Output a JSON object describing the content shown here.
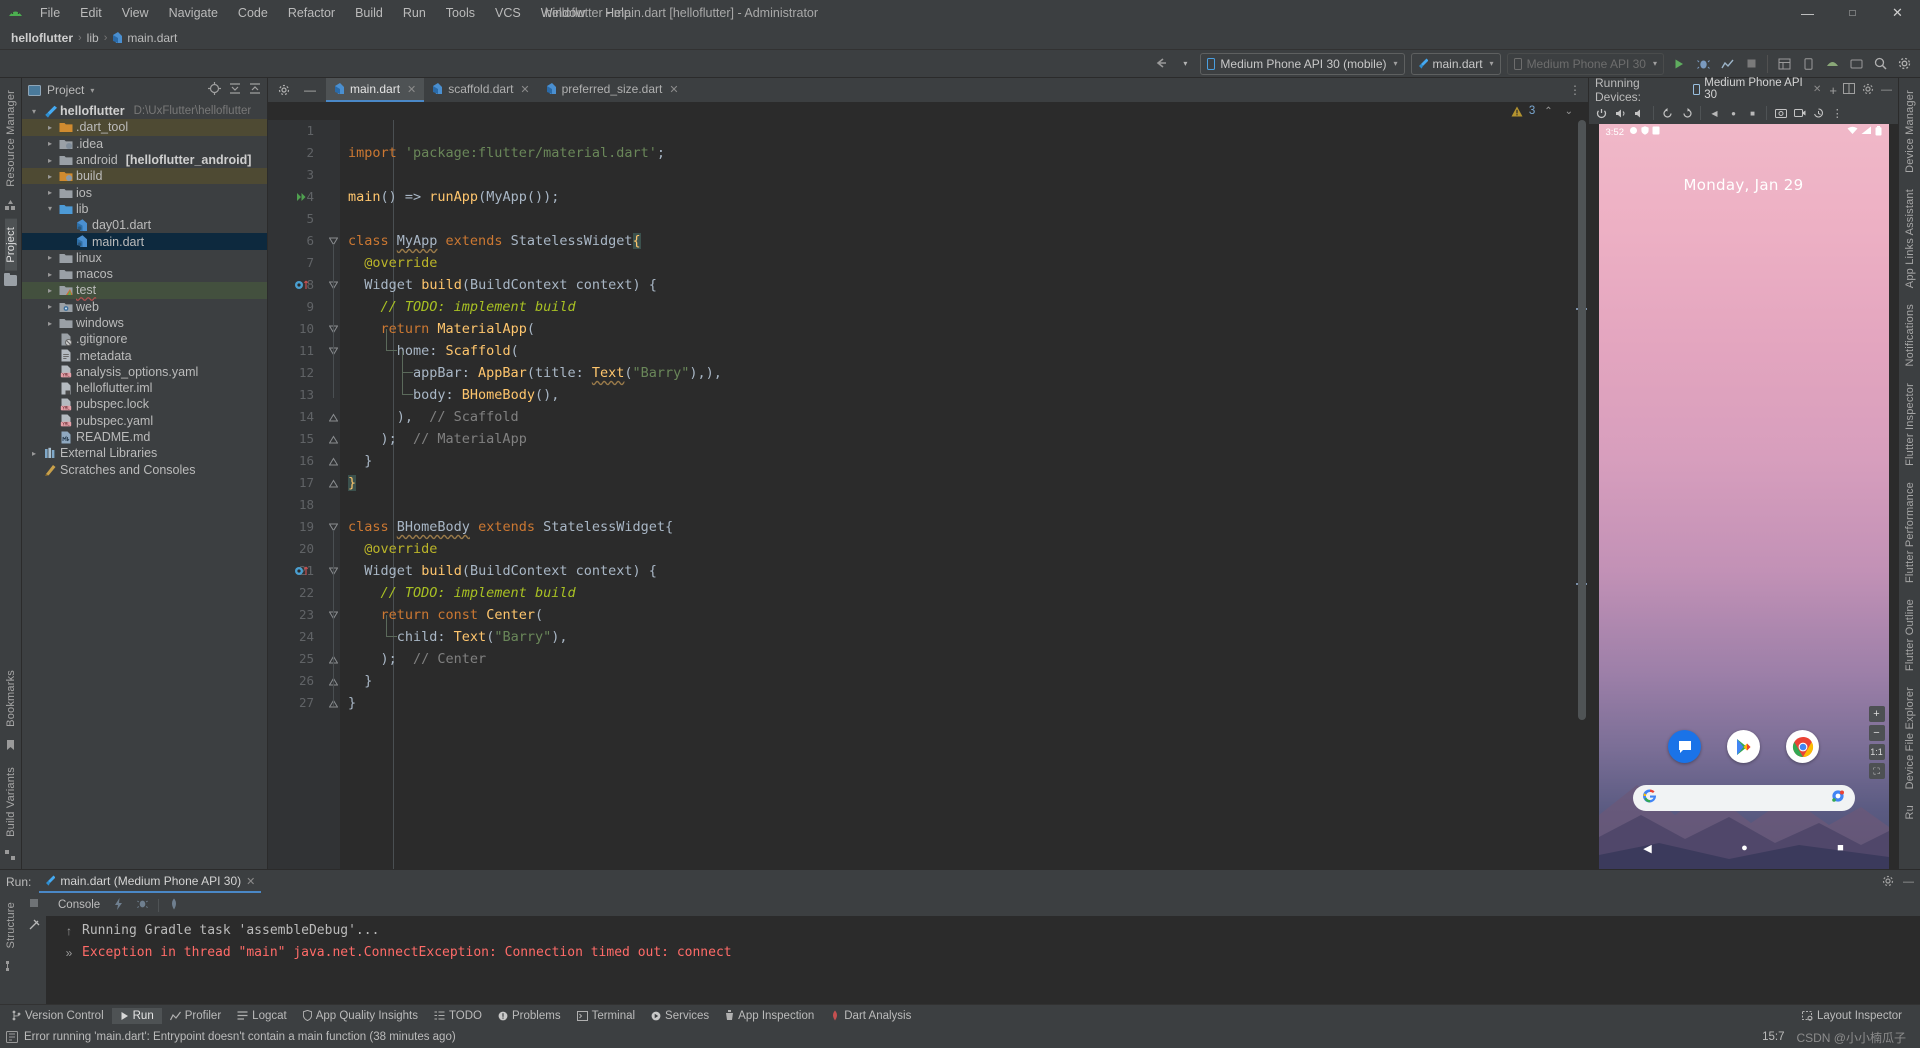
{
  "window": {
    "title": "helloflutter - main.dart [helloflutter] - Administrator",
    "minimize": "—",
    "maximize": "☐",
    "close": "✕"
  },
  "menubar": {
    "items": [
      {
        "label": "File"
      },
      {
        "label": "Edit"
      },
      {
        "label": "View"
      },
      {
        "label": "Navigate"
      },
      {
        "label": "Code"
      },
      {
        "label": "Refactor"
      },
      {
        "label": "Build"
      },
      {
        "label": "Run"
      },
      {
        "label": "Tools"
      },
      {
        "label": "VCS"
      },
      {
        "label": "Window"
      },
      {
        "label": "Help"
      }
    ]
  },
  "breadcrumb": {
    "project": "helloflutter",
    "folder": "lib",
    "file": "main.dart",
    "separator": "›"
  },
  "toolbar": {
    "device_combo": "Medium Phone API 30 (mobile)",
    "run_config_combo": "main.dart",
    "device_combo2": "Medium Phone API 30",
    "run_icon": "▶",
    "debug_icon": "🐞",
    "stop_icon": "■",
    "caret": "▾",
    "search_icon": "🔍",
    "settings_icon": "⚙",
    "back_arrow": "↰"
  },
  "left_strips": [
    {
      "label": "Resource Manager",
      "active": false
    },
    {
      "label": "Project",
      "active": true
    }
  ],
  "left_strips_bottom": [
    {
      "label": "Bookmarks"
    },
    {
      "label": "Build Variants"
    },
    {
      "label": "Structure"
    }
  ],
  "right_strips": [
    {
      "label": "Device Manager"
    },
    {
      "label": "App Links Assistant"
    },
    {
      "label": "Notifications"
    },
    {
      "label": "Flutter Inspector"
    },
    {
      "label": "Flutter Performance"
    },
    {
      "label": "Flutter Outline"
    },
    {
      "label": "Device File Explorer"
    },
    {
      "label": "Ru"
    }
  ],
  "project_panel": {
    "title": "Project",
    "caret": "▾",
    "tools": [
      "⊕",
      "⤓",
      "⤒"
    ],
    "tree": [
      {
        "depth": 0,
        "arrow": "v",
        "icon": "flutter",
        "label": "helloflutter",
        "bold": true,
        "sub": "D:\\UxFlutter\\helloflutter",
        "state": "none"
      },
      {
        "depth": 1,
        "arrow": ">",
        "icon": "folder-orange",
        "label": ".dart_tool",
        "state": "yellow"
      },
      {
        "depth": 1,
        "arrow": ">",
        "icon": "folder-module",
        "label": ".idea",
        "state": "none"
      },
      {
        "depth": 1,
        "arrow": ">",
        "icon": "folder-grey",
        "label": "android",
        "suffix": "[helloflutter_android]",
        "state": "none"
      },
      {
        "depth": 1,
        "arrow": ">",
        "icon": "folder-orange-mod",
        "label": "build",
        "state": "yellow"
      },
      {
        "depth": 1,
        "arrow": ">",
        "icon": "folder-grey",
        "label": "ios",
        "state": "none"
      },
      {
        "depth": 1,
        "arrow": "v",
        "icon": "folder-blue",
        "label": "lib",
        "state": "none"
      },
      {
        "depth": 2,
        "arrow": "",
        "icon": "dart",
        "label": "day01.dart",
        "state": "none"
      },
      {
        "depth": 2,
        "arrow": "",
        "icon": "dart",
        "label": "main.dart",
        "state": "selected"
      },
      {
        "depth": 1,
        "arrow": ">",
        "icon": "folder-grey",
        "label": "linux",
        "state": "none"
      },
      {
        "depth": 1,
        "arrow": ">",
        "icon": "folder-grey",
        "label": "macos",
        "state": "none"
      },
      {
        "depth": 1,
        "arrow": ">",
        "icon": "folder-test",
        "label": "test",
        "state": "green",
        "squiggle": true
      },
      {
        "depth": 1,
        "arrow": ">",
        "icon": "folder-web",
        "label": "web",
        "state": "none"
      },
      {
        "depth": 1,
        "arrow": ">",
        "icon": "folder-grey",
        "label": "windows",
        "state": "none"
      },
      {
        "depth": 1,
        "arrow": "",
        "icon": "gitignore",
        "label": ".gitignore",
        "state": "none"
      },
      {
        "depth": 1,
        "arrow": "",
        "icon": "file",
        "label": ".metadata",
        "state": "none"
      },
      {
        "depth": 1,
        "arrow": "",
        "icon": "yaml",
        "label": "analysis_options.yaml",
        "state": "none"
      },
      {
        "depth": 1,
        "arrow": "",
        "icon": "iml",
        "label": "helloflutter.iml",
        "state": "none"
      },
      {
        "depth": 1,
        "arrow": "",
        "icon": "yaml",
        "label": "pubspec.lock",
        "state": "none"
      },
      {
        "depth": 1,
        "arrow": "",
        "icon": "yaml",
        "label": "pubspec.yaml",
        "state": "none"
      },
      {
        "depth": 1,
        "arrow": "",
        "icon": "md",
        "label": "README.md",
        "state": "none"
      },
      {
        "depth": 0,
        "arrow": ">",
        "icon": "libs",
        "label": "External Libraries",
        "state": "none"
      },
      {
        "depth": 0,
        "arrow": "",
        "icon": "scratch",
        "label": "Scratches and Consoles",
        "state": "none"
      }
    ]
  },
  "editor": {
    "gear_icon": "⚙",
    "minimize_icon": "—",
    "tabs": [
      {
        "label": "main.dart",
        "active": true,
        "close": "✕"
      },
      {
        "label": "scaffold.dart",
        "active": false,
        "close": "✕"
      },
      {
        "label": "preferred_size.dart",
        "active": false,
        "close": "✕"
      }
    ],
    "tab_right_icon": "⋮",
    "warning_count": "3",
    "warning_icon": "⚠",
    "chev_up": "⌃",
    "chev_down": "⌄",
    "lines": [
      {
        "n": 1,
        "text": "",
        "tokens": []
      },
      {
        "n": 2,
        "tokens": [
          {
            "t": "import ",
            "c": "k"
          },
          {
            "t": "'package:flutter/material.dart'",
            "c": "st"
          },
          {
            "t": ";",
            "c": "pu"
          }
        ]
      },
      {
        "n": 3,
        "tokens": []
      },
      {
        "n": 4,
        "gutter": "run",
        "tokens": [
          {
            "t": "main",
            "c": "fn"
          },
          {
            "t": "() => ",
            "c": "pu"
          },
          {
            "t": "runApp",
            "c": "fn"
          },
          {
            "t": "(",
            "c": "pu"
          },
          {
            "t": "MyApp",
            "c": "ty"
          },
          {
            "t": "());",
            "c": "pu"
          }
        ]
      },
      {
        "n": 5,
        "tokens": []
      },
      {
        "n": 6,
        "fold": "collapse",
        "tokens": [
          {
            "t": "class ",
            "c": "k"
          },
          {
            "t": "MyApp",
            "c": "ty warn-under"
          },
          {
            "t": " extends ",
            "c": "k"
          },
          {
            "t": "StatelessWidget",
            "c": "ty"
          },
          {
            "t": "{",
            "c": "curly-hl"
          }
        ]
      },
      {
        "n": 7,
        "tokens": [
          {
            "t": "  @override",
            "c": "an"
          }
        ]
      },
      {
        "n": 8,
        "gutter": "override",
        "fold": "collapse",
        "tokens": [
          {
            "t": "  ",
            "c": "pu"
          },
          {
            "t": "Widget",
            "c": "ty"
          },
          {
            "t": " ",
            "c": "pu"
          },
          {
            "t": "build",
            "c": "fn"
          },
          {
            "t": "(",
            "c": "pu"
          },
          {
            "t": "BuildContext",
            "c": "ty"
          },
          {
            "t": " context) {",
            "c": "pu"
          }
        ]
      },
      {
        "n": 9,
        "tokens": [
          {
            "t": "    ",
            "c": "pu"
          },
          {
            "t": "// TODO: implement build",
            "c": "todo"
          }
        ]
      },
      {
        "n": 10,
        "fold": "collapse",
        "tokens": [
          {
            "t": "    ",
            "c": "pu"
          },
          {
            "t": "return ",
            "c": "k"
          },
          {
            "t": "MaterialApp",
            "c": "fn"
          },
          {
            "t": "(",
            "c": "pu"
          }
        ]
      },
      {
        "n": 11,
        "fold": "collapse",
        "tokens": [
          {
            "t": "      home: ",
            "c": "pu"
          },
          {
            "t": "Scaffold",
            "c": "fn"
          },
          {
            "t": "(",
            "c": "pu"
          }
        ]
      },
      {
        "n": 12,
        "tokens": [
          {
            "t": "        appBar: ",
            "c": "pu"
          },
          {
            "t": "AppBar",
            "c": "fn"
          },
          {
            "t": "(title: ",
            "c": "pu"
          },
          {
            "t": "Text",
            "c": "fn warn-under"
          },
          {
            "t": "(",
            "c": "pu"
          },
          {
            "t": "\"Barry\"",
            "c": "st"
          },
          {
            "t": "),),",
            "c": "pu"
          }
        ]
      },
      {
        "n": 13,
        "tokens": [
          {
            "t": "        body: ",
            "c": "pu"
          },
          {
            "t": "BHomeBody",
            "c": "fn"
          },
          {
            "t": "(),",
            "c": "pu"
          }
        ]
      },
      {
        "n": 14,
        "fold": "end",
        "tokens": [
          {
            "t": "      ),  ",
            "c": "pu"
          },
          {
            "t": "// Scaffold",
            "c": "cm"
          }
        ]
      },
      {
        "n": 15,
        "fold": "end",
        "tokens": [
          {
            "t": "    );  ",
            "c": "pu"
          },
          {
            "t": "// MaterialApp",
            "c": "cm"
          }
        ]
      },
      {
        "n": 16,
        "fold": "end",
        "tokens": [
          {
            "t": "  }",
            "c": "pu"
          }
        ]
      },
      {
        "n": 17,
        "fold": "end",
        "tokens": [
          {
            "t": "}",
            "c": "curly-hl"
          }
        ]
      },
      {
        "n": 18,
        "tokens": []
      },
      {
        "n": 19,
        "fold": "collapse",
        "tokens": [
          {
            "t": "class ",
            "c": "k"
          },
          {
            "t": "BHomeBody",
            "c": "ty warn-under"
          },
          {
            "t": " extends ",
            "c": "k"
          },
          {
            "t": "StatelessWidget",
            "c": "ty"
          },
          {
            "t": "{",
            "c": "pu"
          }
        ]
      },
      {
        "n": 20,
        "tokens": [
          {
            "t": "  @override",
            "c": "an"
          }
        ]
      },
      {
        "n": 21,
        "gutter": "override",
        "fold": "collapse",
        "tokens": [
          {
            "t": "  ",
            "c": "pu"
          },
          {
            "t": "Widget",
            "c": "ty"
          },
          {
            "t": " ",
            "c": "pu"
          },
          {
            "t": "build",
            "c": "fn"
          },
          {
            "t": "(",
            "c": "pu"
          },
          {
            "t": "BuildContext",
            "c": "ty"
          },
          {
            "t": " context) {",
            "c": "pu"
          }
        ]
      },
      {
        "n": 22,
        "tokens": [
          {
            "t": "    ",
            "c": "pu"
          },
          {
            "t": "// TODO: implement build",
            "c": "todo"
          }
        ]
      },
      {
        "n": 23,
        "fold": "collapse",
        "tokens": [
          {
            "t": "    ",
            "c": "pu"
          },
          {
            "t": "return const ",
            "c": "k"
          },
          {
            "t": "Center",
            "c": "fn"
          },
          {
            "t": "(",
            "c": "pu"
          }
        ]
      },
      {
        "n": 24,
        "tokens": [
          {
            "t": "      child: ",
            "c": "pu"
          },
          {
            "t": "Text",
            "c": "fn"
          },
          {
            "t": "(",
            "c": "pu"
          },
          {
            "t": "\"Barry\"",
            "c": "st"
          },
          {
            "t": "),",
            "c": "pu"
          }
        ]
      },
      {
        "n": 25,
        "fold": "end",
        "tokens": [
          {
            "t": "    );  ",
            "c": "pu"
          },
          {
            "t": "// Center",
            "c": "cm"
          }
        ]
      },
      {
        "n": 26,
        "fold": "end",
        "tokens": [
          {
            "t": "  }",
            "c": "pu"
          }
        ]
      },
      {
        "n": 27,
        "fold": "end",
        "tokens": [
          {
            "t": "}",
            "c": "pu"
          }
        ]
      }
    ]
  },
  "emulator": {
    "title": "Running Devices:",
    "tab_label": "Medium Phone API 30",
    "tab_close": "✕",
    "add_icon": "+",
    "split_icon": "◫",
    "gear_icon": "⚙",
    "minimize_icon": "—",
    "toolbar_icons": [
      "power",
      "volume-up",
      "volume-down",
      "rotate-left",
      "rotate-right",
      "back",
      "home",
      "overview",
      "screenshot",
      "record",
      "snapshot",
      "more"
    ],
    "phone": {
      "status_time": "3:52",
      "date_text": "Monday, Jan 29",
      "search_placeholder": "",
      "nav_back": "◀",
      "nav_home": "●",
      "nav_recent": "■",
      "zoom_in": "+",
      "zoom_out": "−",
      "zoom_level": "1:1",
      "zoom_fit": "⛶",
      "apps": [
        "messages",
        "play-store",
        "chrome"
      ]
    }
  },
  "run_panel": {
    "label": "Run:",
    "tab_title": "main.dart (Medium Phone API 30)",
    "tab_close": "✕",
    "console_tab": "Console",
    "tools": [
      "⚡",
      "🐞",
      "📷"
    ],
    "stop_icon": "■",
    "scroll_up_icon": "↑",
    "expand_icon": "»",
    "pin_icon": "↗",
    "output": [
      {
        "text": "Running Gradle task 'assembleDebug'...",
        "type": "normal"
      },
      {
        "text": "Exception in thread \"main\" java.net.ConnectException: Connection timed out: connect",
        "type": "error"
      }
    ],
    "head_tools": [
      "⚙",
      "—"
    ]
  },
  "bottom_bar": {
    "items": [
      {
        "label": "Version Control",
        "icon": "branch",
        "active": false
      },
      {
        "label": "Run",
        "icon": "play",
        "active": true
      },
      {
        "label": "Profiler",
        "icon": "chart",
        "active": false
      },
      {
        "label": "Logcat",
        "icon": "list",
        "active": false
      },
      {
        "label": "App Quality Insights",
        "icon": "shield",
        "active": false
      },
      {
        "label": "TODO",
        "icon": "todo",
        "active": false
      },
      {
        "label": "Problems",
        "icon": "error",
        "active": false
      },
      {
        "label": "Terminal",
        "icon": "terminal",
        "active": false
      },
      {
        "label": "Services",
        "icon": "services",
        "active": false
      },
      {
        "label": "App Inspection",
        "icon": "inspect",
        "active": false
      },
      {
        "label": "Dart Analysis",
        "icon": "dart",
        "active": false
      }
    ],
    "right": [
      {
        "label": "Layout Inspector",
        "icon": "layout"
      }
    ]
  },
  "status_bar": {
    "message": "Error running 'main.dart': Entrypoint doesn't contain a main function (38 minutes ago)",
    "caret_position": "15:7",
    "encoding": "",
    "watermark": "CSDN @小小楠瓜子"
  }
}
